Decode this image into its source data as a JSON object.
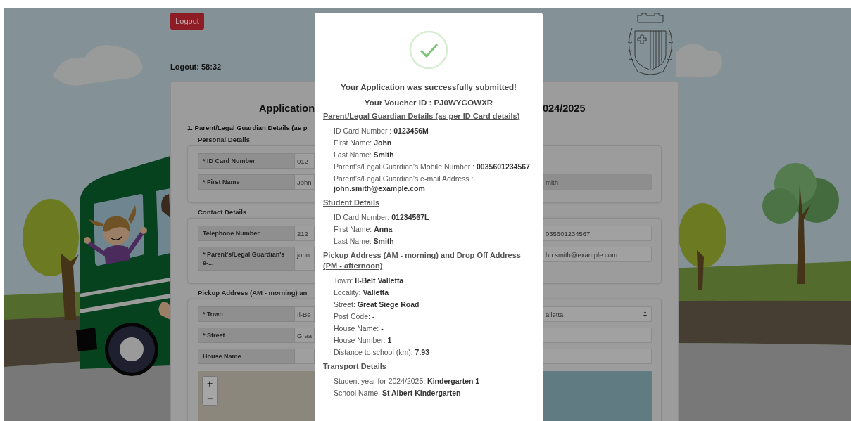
{
  "header": {
    "logout_button": "Logout",
    "session_timer": "Logout: 58:32"
  },
  "form": {
    "title_left": "Application",
    "title_right": "024/2025",
    "section_heading": "1. Parent/Legal Guardian Details (as p",
    "groups": [
      {
        "legend": "Personal Details",
        "rows": [
          {
            "label": "* ID Card Number",
            "value": "012"
          },
          {
            "label": "* First Name",
            "value": "John",
            "right": {
              "kind": "text",
              "value": "mith",
              "disabled": true
            }
          }
        ]
      },
      {
        "legend": "Contact Details",
        "rows": [
          {
            "label": "Telephone Number",
            "value": "212",
            "right": {
              "kind": "text",
              "value": "035601234567",
              "disabled": false
            }
          },
          {
            "label": "* Parent's/Legal Guardian's e-...",
            "value": "john",
            "right": {
              "kind": "text",
              "value": "hn.smith@example.com",
              "disabled": false
            }
          }
        ]
      },
      {
        "legend": "Pickup Address (AM - morning) an",
        "rows": [
          {
            "label": "* Town",
            "value": "Il-Be",
            "right": {
              "kind": "select",
              "value": "alletta",
              "disabled": false
            }
          },
          {
            "label": "* Street",
            "value": "Grea",
            "right": {
              "kind": "text",
              "disabled": false
            }
          },
          {
            "label": "House Name",
            "right": {
              "kind": "text",
              "disabled": false
            }
          }
        ],
        "map": {
          "zoom_in": "+",
          "zoom_out": "−"
        }
      }
    ]
  },
  "modal": {
    "title": "Your Application was successfully submitted!",
    "voucher": "Your Voucher ID : PJ0WYGOWXR",
    "sections": [
      {
        "heading": "Parent/Legal Guardian Details (as per ID Card details)",
        "items": [
          "ID Card Number : **0123456M**",
          "First Name: **John**",
          "Last Name: **Smith**",
          "Parent's/Legal Guardian's Mobile Number : **0035601234567**",
          "Parent's/Legal Guardian's e-mail Address : **john.smith@example.com**"
        ]
      },
      {
        "heading": "Student Details",
        "items": [
          "ID Card Number: **01234567L**",
          "First Name: **Anna**",
          "Last Name: **Smith**"
        ]
      },
      {
        "heading": "Pickup Address (AM - morning) and Drop Off Address (PM - afternoon)",
        "items": [
          "Town: **Il-Belt Valletta**",
          "Locality: **Valletta**",
          "Street: **Great Siege Road**",
          "Post Code: **-**",
          "House Name: **-**",
          "House Number: **1**",
          "Distance to school (km): **7.93**"
        ]
      },
      {
        "heading": "Transport Details",
        "items": [
          "Student year for 2024/2025: **Kindergarten 1**",
          "School Name: **St Albert Kindergarten**"
        ]
      }
    ]
  }
}
